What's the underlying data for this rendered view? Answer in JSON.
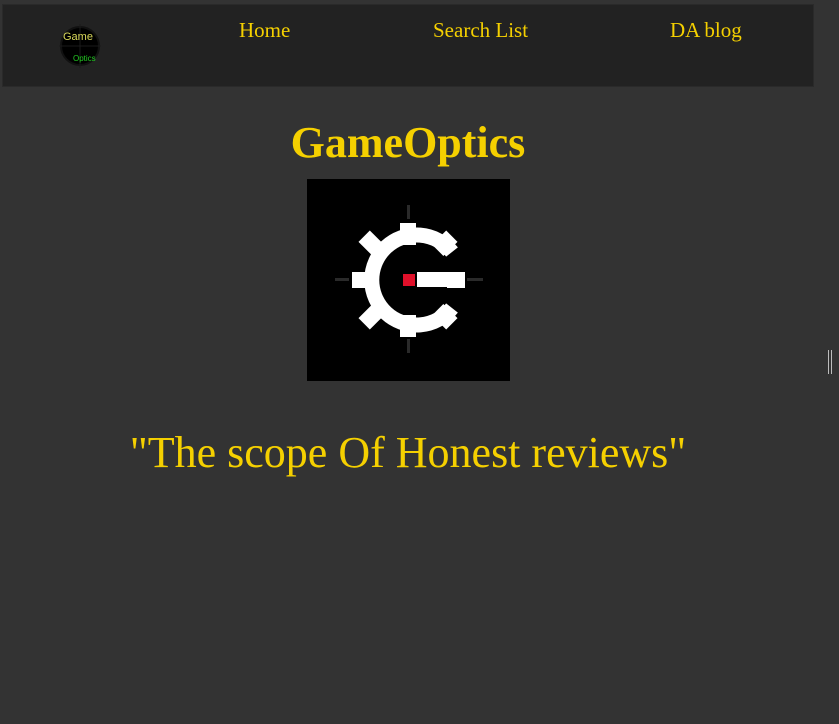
{
  "nav": {
    "logo_text_top": "Game",
    "logo_text_bottom": "Optics",
    "links": [
      {
        "label": "Home"
      },
      {
        "label": "Search List"
      },
      {
        "label": "DA blog"
      }
    ]
  },
  "main": {
    "title": "GameOptics",
    "tagline": "\"The scope Of Honest reviews\""
  },
  "colors": {
    "background": "#333333",
    "navbar": "#222222",
    "accent_yellow": "#f5d000",
    "logo_green": "#22cc22",
    "logo_red": "#e0102a"
  },
  "icons": {
    "nav_logo": "crosshair-scope-icon",
    "hero_logo": "gear-crosshair-icon",
    "resize": "resize-handle-icon"
  }
}
